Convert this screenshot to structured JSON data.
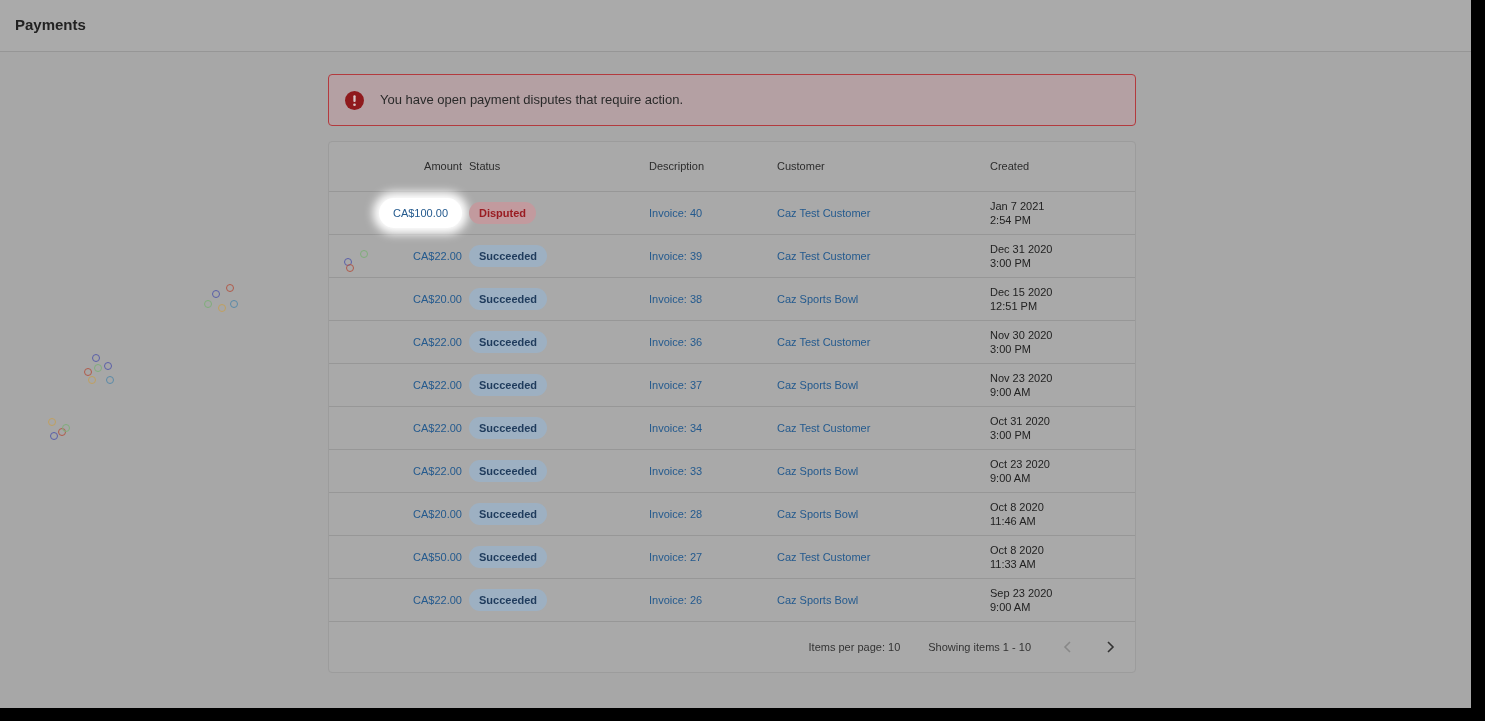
{
  "header": {
    "title": "Payments"
  },
  "alert": {
    "message": "You have open payment disputes that require action."
  },
  "table": {
    "columns": [
      "Amount",
      "Status",
      "Description",
      "Customer",
      "Created"
    ],
    "rows": [
      {
        "amount": "CA$100.00",
        "highlighted": true,
        "status": {
          "label": "Disputed",
          "kind": "disputed"
        },
        "description": "Invoice: 40",
        "customer": "Caz Test Customer",
        "date": "Jan 7 2021",
        "time": "2:54 PM"
      },
      {
        "amount": "CA$22.00",
        "highlighted": false,
        "status": {
          "label": "Succeeded",
          "kind": "succeeded"
        },
        "description": "Invoice: 39",
        "customer": "Caz Test Customer",
        "date": "Dec 31 2020",
        "time": "3:00 PM"
      },
      {
        "amount": "CA$20.00",
        "highlighted": false,
        "status": {
          "label": "Succeeded",
          "kind": "succeeded"
        },
        "description": "Invoice: 38",
        "customer": "Caz Sports Bowl",
        "date": "Dec 15 2020",
        "time": "12:51 PM"
      },
      {
        "amount": "CA$22.00",
        "highlighted": false,
        "status": {
          "label": "Succeeded",
          "kind": "succeeded"
        },
        "description": "Invoice: 36",
        "customer": "Caz Test Customer",
        "date": "Nov 30 2020",
        "time": "3:00 PM"
      },
      {
        "amount": "CA$22.00",
        "highlighted": false,
        "status": {
          "label": "Succeeded",
          "kind": "succeeded"
        },
        "description": "Invoice: 37",
        "customer": "Caz Sports Bowl",
        "date": "Nov 23 2020",
        "time": "9:00 AM"
      },
      {
        "amount": "CA$22.00",
        "highlighted": false,
        "status": {
          "label": "Succeeded",
          "kind": "succeeded"
        },
        "description": "Invoice: 34",
        "customer": "Caz Test Customer",
        "date": "Oct 31 2020",
        "time": "3:00 PM"
      },
      {
        "amount": "CA$22.00",
        "highlighted": false,
        "status": {
          "label": "Succeeded",
          "kind": "succeeded"
        },
        "description": "Invoice: 33",
        "customer": "Caz Sports Bowl",
        "date": "Oct 23 2020",
        "time": "9:00 AM"
      },
      {
        "amount": "CA$20.00",
        "highlighted": false,
        "status": {
          "label": "Succeeded",
          "kind": "succeeded"
        },
        "description": "Invoice: 28",
        "customer": "Caz Sports Bowl",
        "date": "Oct 8 2020",
        "time": "11:46 AM"
      },
      {
        "amount": "CA$50.00",
        "highlighted": false,
        "status": {
          "label": "Succeeded",
          "kind": "succeeded"
        },
        "description": "Invoice: 27",
        "customer": "Caz Test Customer",
        "date": "Oct 8 2020",
        "time": "11:33 AM"
      },
      {
        "amount": "CA$22.00",
        "highlighted": false,
        "status": {
          "label": "Succeeded",
          "kind": "succeeded"
        },
        "description": "Invoice: 26",
        "customer": "Caz Sports Bowl",
        "date": "Sep 23 2020",
        "time": "9:00 AM"
      }
    ]
  },
  "pagination": {
    "items_per_page": "Items per page: 10",
    "showing": "Showing items 1 - 10",
    "previous_disabled": true,
    "next_disabled": false
  }
}
